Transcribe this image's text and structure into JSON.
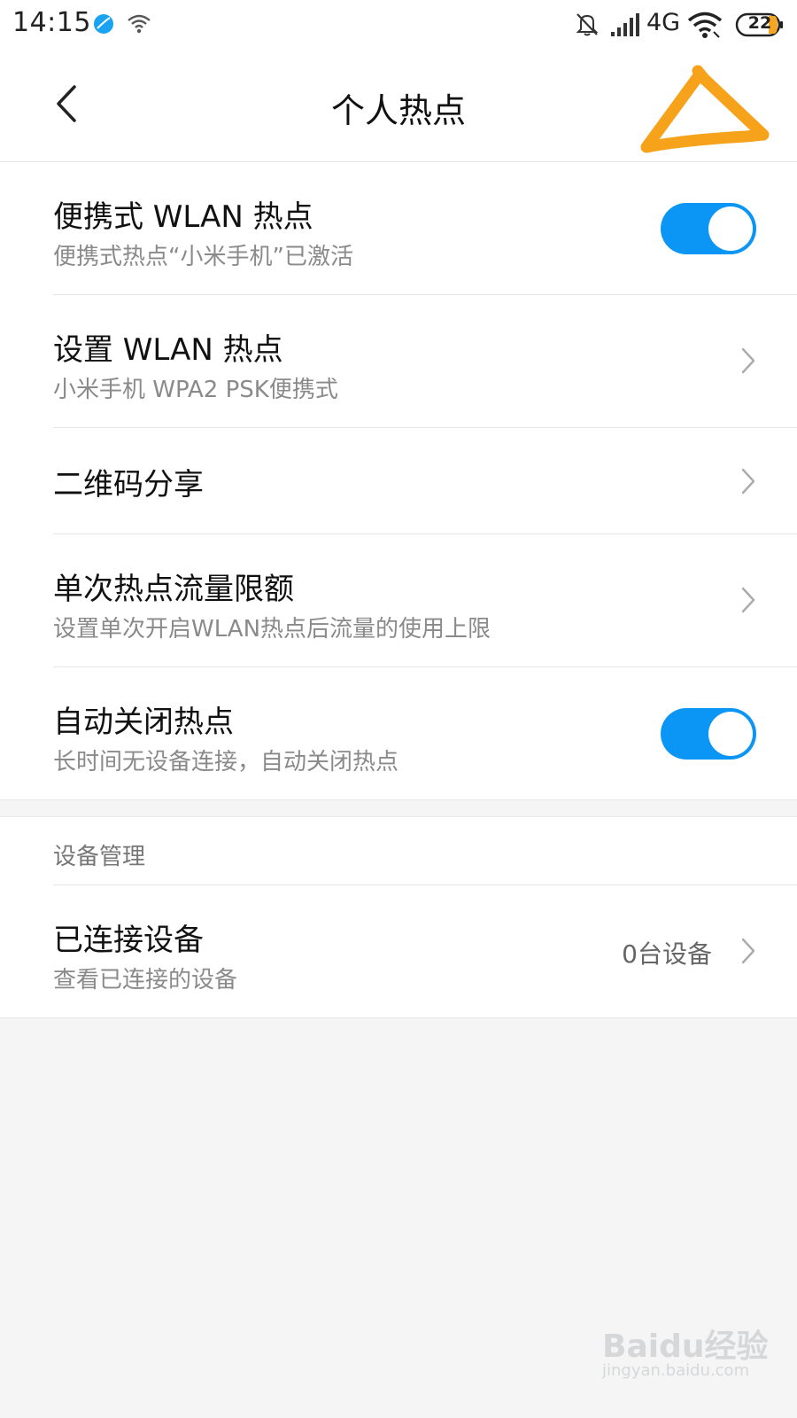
{
  "status_bar": {
    "time": "14:15",
    "network": "4G",
    "battery": "22",
    "icons": [
      "app-notification-icon",
      "wifi-hotspot-icon",
      "bell-muted-icon",
      "signal-bars-icon",
      "wifi-icon",
      "battery-icon"
    ]
  },
  "header": {
    "back_icon": "chevron-left-icon",
    "title": "个人热点"
  },
  "settings": [
    {
      "title": "便携式 WLAN 热点",
      "subtitle": "便携式热点“小米手机”已激活",
      "control": "toggle",
      "enabled": true
    },
    {
      "title": "设置 WLAN 热点",
      "subtitle": "小米手机 WPA2 PSK便携式",
      "control": "chevron"
    },
    {
      "title": "二维码分享",
      "control": "chevron"
    },
    {
      "title": "单次热点流量限额",
      "subtitle": "设置单次开启WLAN热点后流量的使用上限",
      "control": "chevron"
    },
    {
      "title": "自动关闭热点",
      "subtitle": "长时间无设备连接，自动关闭热点",
      "control": "toggle",
      "enabled": true
    }
  ],
  "device_section": {
    "label": "设备管理",
    "connected": {
      "title": "已连接设备",
      "subtitle": "查看已连接的设备",
      "value": "0台设备",
      "control": "chevron"
    }
  },
  "watermark": {
    "brand": "Baidu经验",
    "url": "jingyan.baidu.com"
  },
  "colors": {
    "toggle_on": "#0b96f5",
    "annotation": "#f7a21b",
    "background": "#f5f5f5"
  }
}
